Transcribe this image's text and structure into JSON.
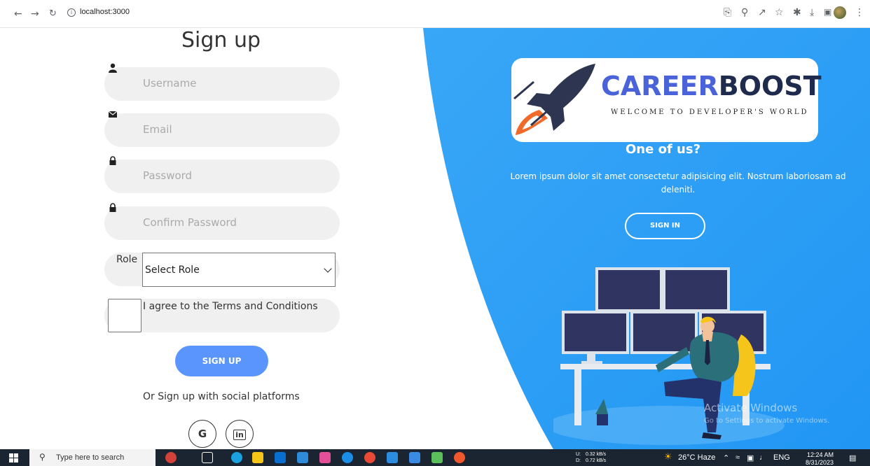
{
  "browser": {
    "url": "localhost:3000"
  },
  "form": {
    "title": "Sign up",
    "username_placeholder": "Username",
    "email_placeholder": "Email",
    "password_placeholder": "Password",
    "confirm_placeholder": "Confirm Password",
    "role_label": "Role",
    "role_selected": "Select Role",
    "terms_label": "I agree to the Terms and Conditions",
    "submit_label": "SIGN UP",
    "social_text": "Or Sign up with social platforms",
    "social_google": "G",
    "social_linkedin": "in"
  },
  "panel": {
    "logo_part1": "CAREER",
    "logo_part2": "BOOST",
    "logo_tagline": "Welcome to developer's world",
    "heading": "One of us?",
    "text": "Lorem ipsum dolor sit amet consectetur adipisicing elit. Nostrum laboriosam ad deleniti.",
    "signin_label": "SIGN IN",
    "watermark": "Activate Windows",
    "watermark_sub": "Go to Settings to activate Windows."
  },
  "taskbar": {
    "search_placeholder": "Type here to search",
    "net_up_label": "U:",
    "net_up": "0.32 kB/s",
    "net_down_label": "D:",
    "net_down": "0.72 kB/s",
    "weather": "26°C Haze",
    "lang": "ENG",
    "time": "12:24 AM",
    "date": "8/31/2023"
  },
  "colors": {
    "primary": "#5995fd",
    "panel_blue": "#2196f3",
    "input_bg": "#f0f0f0"
  }
}
